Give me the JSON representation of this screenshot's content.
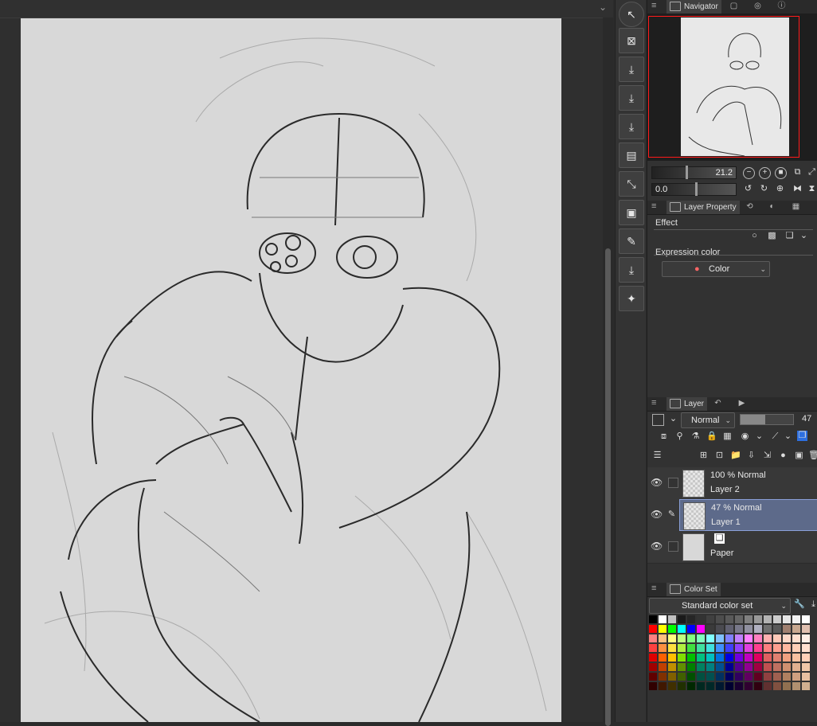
{
  "navigator": {
    "tab_label": "Navigator",
    "zoom_value": "21.2",
    "rotation_value": "0.0"
  },
  "layer_property": {
    "tab_label": "Layer Property",
    "effect_label": "Effect",
    "expression_color_label": "Expression color",
    "expression_color_value": "Color"
  },
  "layer_panel": {
    "tab_label": "Layer",
    "blend_mode": "Normal",
    "opacity_value": "47",
    "layers": [
      {
        "mode": "100 % Normal",
        "name": "Layer 2"
      },
      {
        "mode": "47 % Normal",
        "name": "Layer 1"
      },
      {
        "mode": "",
        "name": "Paper"
      }
    ]
  },
  "color_set": {
    "tab_label": "Color Set",
    "set_name": "Standard color set",
    "colors": [
      [
        "#000000",
        "#ffffff",
        "#c0c0c0",
        "#1a1a1a",
        "#262626",
        "#333333",
        "#404040",
        "#4d4d4d",
        "#595959",
        "#666666",
        "#808080",
        "#999999",
        "#b3b3b3",
        "#cccccc",
        "#e6e6e6",
        "#f2f2f2",
        "#ffffff"
      ],
      [
        "#ff0000",
        "#ffff00",
        "#00ff00",
        "#00ffff",
        "#0000ff",
        "#ff00ff",
        "#3b3b3b",
        "#4a4a50",
        "#606070",
        "#78788a",
        "#9090a0",
        "#b0b0c0",
        "#707070",
        "#5a5a5a",
        "#a08070",
        "#c8a890",
        "#e0c0b0"
      ],
      [
        "#ff8080",
        "#ffc080",
        "#ffff80",
        "#c0ff80",
        "#80ff80",
        "#80ffc0",
        "#80ffff",
        "#80c0ff",
        "#8080ff",
        "#c080ff",
        "#ff80ff",
        "#ff80c0",
        "#ffb0b0",
        "#ffc8b8",
        "#ffd8c8",
        "#ffe0d0",
        "#fff0e8"
      ],
      [
        "#ff4040",
        "#ff9040",
        "#ffe040",
        "#b0f040",
        "#40e040",
        "#40e0a0",
        "#40e0e0",
        "#4090ff",
        "#4040ff",
        "#9040ff",
        "#e040e0",
        "#ff4090",
        "#ff8080",
        "#ffa090",
        "#ffb8a0",
        "#ffd0b8",
        "#ffe0d0"
      ],
      [
        "#e00000",
        "#ff6000",
        "#ffc000",
        "#80e000",
        "#00c000",
        "#00c080",
        "#00c0c0",
        "#0070e0",
        "#0000e0",
        "#7000e0",
        "#c000c0",
        "#e00060",
        "#e06060",
        "#e08070",
        "#f0a080",
        "#f8c0a0",
        "#ffd0b8"
      ],
      [
        "#a00000",
        "#c04000",
        "#c09000",
        "#609000",
        "#008000",
        "#008060",
        "#008080",
        "#005090",
        "#000090",
        "#500090",
        "#900090",
        "#a00040",
        "#c05050",
        "#c07060",
        "#d09070",
        "#e0b090",
        "#f0c8a8"
      ],
      [
        "#600000",
        "#803000",
        "#806000",
        "#406000",
        "#005000",
        "#005040",
        "#005050",
        "#003060",
        "#000060",
        "#300060",
        "#600060",
        "#600020",
        "#904040",
        "#a06050",
        "#b08060",
        "#d0a080",
        "#e8c0a0"
      ],
      [
        "#300000",
        "#401800",
        "#403000",
        "#203000",
        "#002800",
        "#002820",
        "#002828",
        "#001830",
        "#000030",
        "#180030",
        "#300030",
        "#300010",
        "#603030",
        "#805040",
        "#907050",
        "#b09070",
        "#d0b090"
      ]
    ]
  }
}
